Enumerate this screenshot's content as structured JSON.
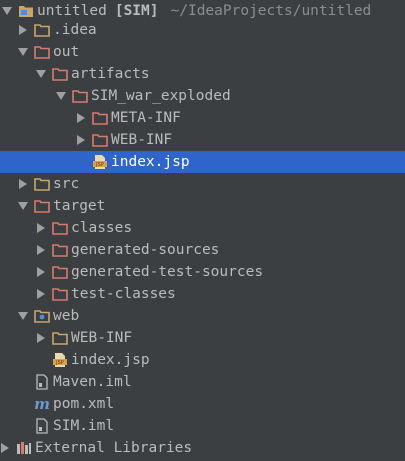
{
  "project": {
    "name": "untitled",
    "module_tag": "[SIM]",
    "path": "~/IdeaProjects/untitled"
  },
  "tree": {
    "idea": ".idea",
    "out": "out",
    "artifacts": "artifacts",
    "sim_war_exploded": "SIM_war_exploded",
    "meta_inf": "META-INF",
    "web_inf_out": "WEB-INF",
    "index_jsp_out": "index.jsp",
    "src": "src",
    "target": "target",
    "classes": "classes",
    "generated_sources": "generated-sources",
    "generated_test_sources": "generated-test-sources",
    "test_classes": "test-classes",
    "web": "web",
    "web_inf_web": "WEB-INF",
    "index_jsp_web": "index.jsp",
    "maven_iml": "Maven.iml",
    "pom_xml": "pom.xml",
    "sim_iml": "SIM.iml",
    "external_libraries": "External Libraries"
  },
  "icon_text": {
    "jsp": "JSP",
    "maven": "m"
  },
  "colors": {
    "background": "#3c3f41",
    "selection": "#2f65ca",
    "text": "#bbbbbb",
    "path_text": "#8c8c8c",
    "folder_tan": "#c8a66a",
    "folder_excluded": "#d97a6a",
    "jsp_icon": "#d4a24c"
  },
  "selected_item": "index.jsp"
}
